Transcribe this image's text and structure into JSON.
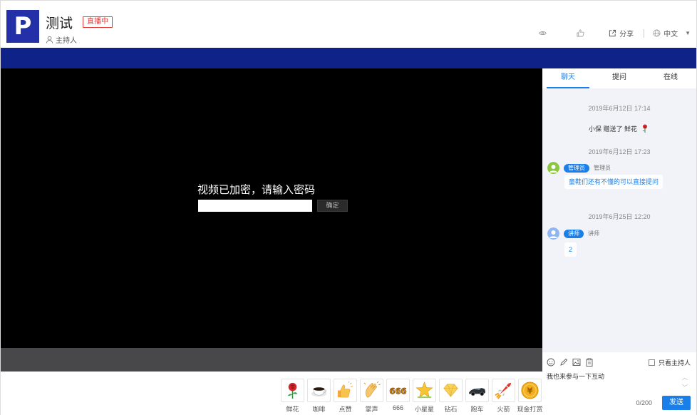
{
  "header": {
    "title": "测试",
    "live_badge": "直播中",
    "host_label": "主持人",
    "share_label": "分享",
    "language": "中文"
  },
  "player": {
    "password_prompt": "视频已加密，请输入密码",
    "password_placeholder": "",
    "confirm_label": "确定"
  },
  "gifts": [
    {
      "label": "鲜花",
      "icon": "flower-icon"
    },
    {
      "label": "咖啡",
      "icon": "coffee-icon"
    },
    {
      "label": "点赞",
      "icon": "thumbs-up-icon"
    },
    {
      "label": "掌声",
      "icon": "clap-icon"
    },
    {
      "label": "666",
      "icon": "six-six-six-icon"
    },
    {
      "label": "小星星",
      "icon": "star-icon"
    },
    {
      "label": "钻石",
      "icon": "diamond-icon"
    },
    {
      "label": "跑车",
      "icon": "sports-car-icon"
    },
    {
      "label": "火箭",
      "icon": "rocket-icon"
    },
    {
      "label": "现金打赏",
      "icon": "coin-icon"
    }
  ],
  "sidebar": {
    "tabs": [
      {
        "label": "聊天",
        "active": true
      },
      {
        "label": "提问",
        "active": false
      },
      {
        "label": "在线",
        "active": false
      }
    ],
    "messages": {
      "time1": "2019年6月12日 17:14",
      "gift_text": "小保 赠送了 鲜花",
      "time2": "2019年6月12日 17:23",
      "admin_badge": "管理员",
      "admin_name": "管理员",
      "admin_text": "童鞋们还有不懂的可以直接提问",
      "time3": "2019年6月25日 12:20",
      "lecturer_badge": "讲师",
      "lecturer_name": "讲师",
      "lecturer_text": "2"
    },
    "input": {
      "host_only_label": "只看主持人",
      "placeholder": "我也来参与一下互动",
      "counter": "0/200",
      "send_label": "发送"
    }
  },
  "colors": {
    "brand_blue": "#2430a8",
    "bar_blue": "#0f2288",
    "accent": "#1a7fe8",
    "live_red": "#e53935"
  }
}
